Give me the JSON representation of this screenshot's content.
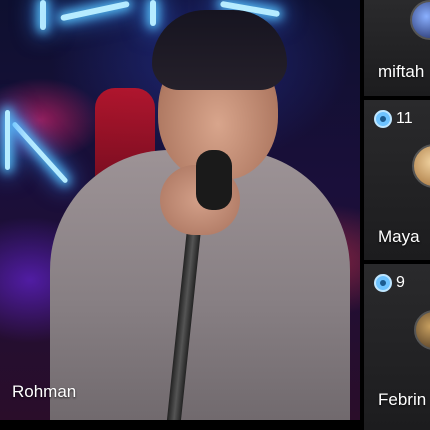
{
  "host": {
    "name": "Rohman"
  },
  "guests": [
    {
      "name": "miftah",
      "coins": ""
    },
    {
      "name": "Maya",
      "coins": "11"
    },
    {
      "name": "Febrin",
      "coins": "9"
    }
  ],
  "icons": {
    "coin": "coin-icon"
  },
  "colors": {
    "background": "#000000",
    "coin": "#6ec3ff",
    "label": "#ffffff"
  }
}
